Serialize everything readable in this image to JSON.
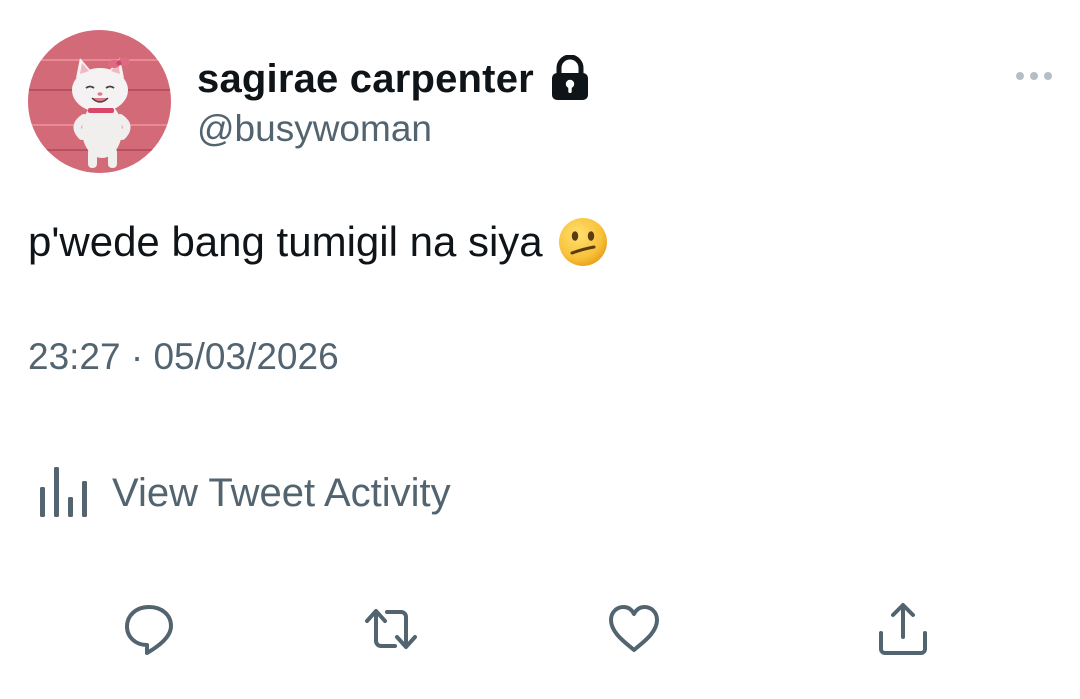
{
  "tweet": {
    "author": {
      "display_name": "sagirae carpenter",
      "handle": "@busywoman",
      "protected_icon": "lock-icon",
      "avatar": "cartoon-white-cat-avatar"
    },
    "text": "p'wede bang tumigil na siya",
    "text_emoji": "confused-face-emoji",
    "timestamp": "23:27 · 05/03/2026",
    "more_icon": "more-horizontal-icon",
    "activity": {
      "icon": "bar-chart-icon",
      "label": "View Tweet Activity"
    },
    "actions": [
      {
        "name": "reply",
        "icon": "reply-icon"
      },
      {
        "name": "retweet",
        "icon": "retweet-icon"
      },
      {
        "name": "like",
        "icon": "heart-icon"
      },
      {
        "name": "share",
        "icon": "share-icon"
      }
    ]
  },
  "colors": {
    "primary_text": "#0f1419",
    "secondary_text": "#536471",
    "background": "#ffffff",
    "avatar_background": "#d9707f"
  }
}
